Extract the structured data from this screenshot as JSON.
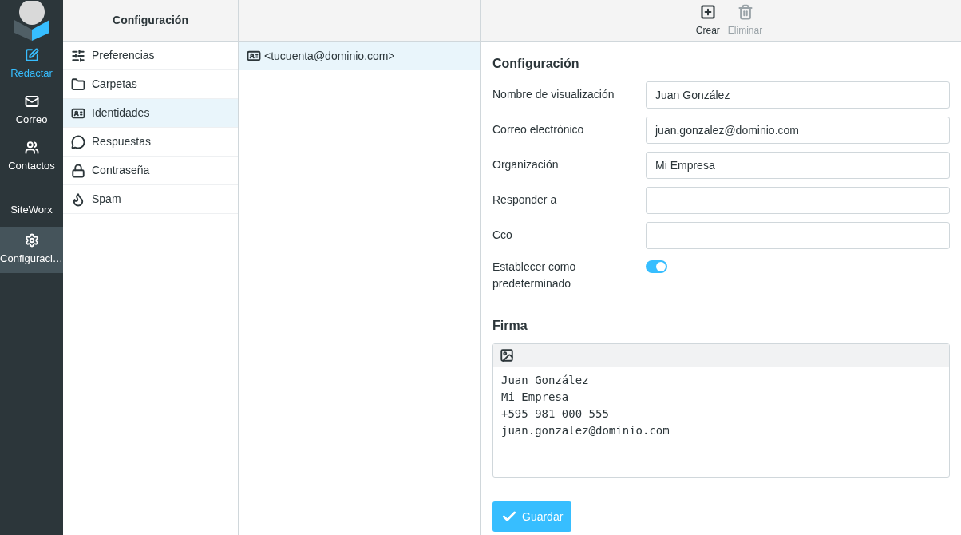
{
  "nav": [
    {
      "label": "Redactar",
      "kind": "compose",
      "selected": false
    },
    {
      "label": "Correo",
      "kind": "nav",
      "selected": false
    },
    {
      "label": "Contactos",
      "kind": "nav",
      "selected": false
    },
    {
      "label": "SiteWorx",
      "kind": "plain",
      "selected": false
    },
    {
      "label": "Configuraci…",
      "kind": "nav",
      "selected": true
    }
  ],
  "settings": {
    "title": "Configuración",
    "items": [
      {
        "label": "Preferencias",
        "selected": false
      },
      {
        "label": "Carpetas",
        "selected": false
      },
      {
        "label": "Identidades",
        "selected": true
      },
      {
        "label": "Respuestas",
        "selected": false
      },
      {
        "label": "Contraseña",
        "selected": false
      },
      {
        "label": "Spam",
        "selected": false
      }
    ]
  },
  "identities": [
    {
      "label": "<tucuenta@dominio.com>",
      "selected": true
    }
  ],
  "toolbar": [
    {
      "label": "Crear",
      "disabled": false
    },
    {
      "label": "Eliminar",
      "disabled": true
    }
  ],
  "form": {
    "title": "Configuración",
    "fields": [
      {
        "label": "Nombre de visualización",
        "value": "Juan González"
      },
      {
        "label": "Correo electrónico",
        "value": "juan.gonzalez@dominio.com"
      },
      {
        "label": "Organización",
        "value": "Mi Empresa"
      },
      {
        "label": "Responder a"
      },
      {
        "label": "Cco"
      }
    ],
    "default_toggle": {
      "label": "Establecer como predeterminado",
      "on": true
    },
    "signature_title": "Firma",
    "signature_lines": [
      "Juan González",
      "Mi Empresa",
      "+595 981 000 555",
      "juan.gonzalez@dominio.com"
    ],
    "save_button": "Guardar"
  }
}
